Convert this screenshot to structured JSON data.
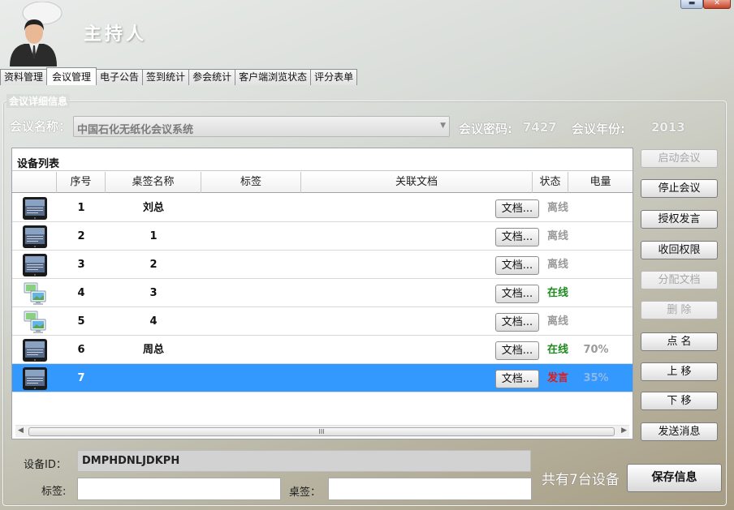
{
  "header": {
    "title": "主持人"
  },
  "tabs": [
    {
      "label": "资料管理",
      "active": false
    },
    {
      "label": "会议管理",
      "active": true
    },
    {
      "label": "电子公告",
      "active": false
    },
    {
      "label": "签到统计",
      "active": false
    },
    {
      "label": "参会统计",
      "active": false
    },
    {
      "label": "客户端浏览状态",
      "active": false
    },
    {
      "label": "评分表单",
      "active": false
    }
  ],
  "details": {
    "group_title": "会议详细信息",
    "meeting_name_label": "会议名称：",
    "meeting_name_value": "中国石化无纸化会议系统",
    "password_label": "会议密码:",
    "password_value": "7427",
    "year_label": "会议年份:",
    "year_value": "2013"
  },
  "device_list": {
    "title": "设备列表",
    "columns": [
      "",
      "序号",
      "桌签名称",
      "标签",
      "关联文档",
      "状态",
      "电量"
    ],
    "doc_button_label": "文档...",
    "rows": [
      {
        "icon": "tablet-icon",
        "index": "1",
        "name": "刘总",
        "tag": "",
        "status": "离线",
        "status_kind": "off",
        "battery": "",
        "selected": false
      },
      {
        "icon": "tablet-icon",
        "index": "2",
        "name": "1",
        "tag": "",
        "status": "离线",
        "status_kind": "off",
        "battery": "",
        "selected": false
      },
      {
        "icon": "tablet-icon",
        "index": "3",
        "name": "2",
        "tag": "",
        "status": "离线",
        "status_kind": "off",
        "battery": "",
        "selected": false
      },
      {
        "icon": "computer-icon",
        "index": "4",
        "name": "3",
        "tag": "",
        "status": "在线",
        "status_kind": "on",
        "battery": "",
        "selected": false
      },
      {
        "icon": "computer-icon",
        "index": "5",
        "name": "4",
        "tag": "",
        "status": "离线",
        "status_kind": "off",
        "battery": "",
        "selected": false
      },
      {
        "icon": "tablet-icon",
        "index": "6",
        "name": "周总",
        "tag": "",
        "status": "在线",
        "status_kind": "on",
        "battery": "70%",
        "selected": false
      },
      {
        "icon": "tablet-icon",
        "index": "7",
        "name": "",
        "tag": "",
        "status": "发言",
        "status_kind": "speak",
        "battery": "35%",
        "selected": true
      }
    ],
    "scroll_grip": "III"
  },
  "side_buttons": [
    {
      "label": "启动会议",
      "enabled": false
    },
    {
      "label": "停止会议",
      "enabled": true
    },
    {
      "label": "授权发言",
      "enabled": true
    },
    {
      "label": "收回权限",
      "enabled": true
    },
    {
      "label": "分配文档",
      "enabled": false
    },
    {
      "label": "删 除",
      "enabled": false
    },
    {
      "label": "点 名",
      "enabled": true
    },
    {
      "label": "上 移",
      "enabled": true
    },
    {
      "label": "下 移",
      "enabled": true
    },
    {
      "label": "发送消息",
      "enabled": true
    }
  ],
  "bottom": {
    "device_id_label": "设备ID：",
    "device_id_value": "DMPHDNLJDKPH",
    "tag_label": "标签:",
    "tag_value": "",
    "desk_label": "桌签：",
    "desk_value": "",
    "count_text": "共有7台设备",
    "save_label": "保存信息"
  },
  "colors": {
    "selected_row": "#3399ff",
    "status_online": "#1f8a1f",
    "status_offline": "#9a9a9a",
    "status_speaking": "#e01a1a"
  }
}
